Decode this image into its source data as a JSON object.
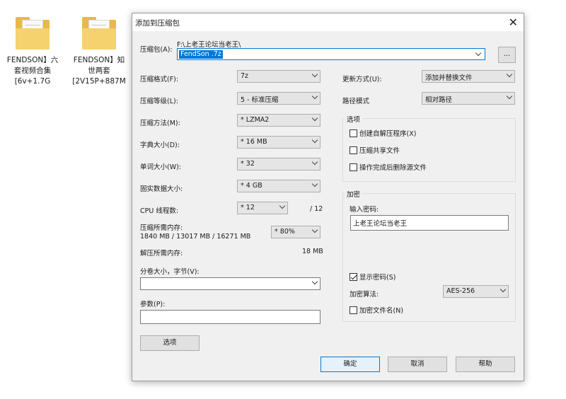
{
  "desktop": {
    "icons": [
      {
        "line1": "FENDSON】六",
        "line2": "套视频合集",
        "line3": "[6v+1.7G"
      },
      {
        "line1": "FENDSON】知",
        "line2": "世两套",
        "line3": "[2V15P+887M"
      }
    ]
  },
  "dialog": {
    "title": "添加到压缩包",
    "close_glyph": "✕",
    "archive": {
      "label": "压缩包(A):",
      "path": "F:\\上老王论坛当老王\\",
      "filename": "FendSon .7z",
      "browse_label": "..."
    },
    "left": {
      "format": {
        "label": "压缩格式(F):",
        "value": "7z"
      },
      "level": {
        "label": "压缩等级(L):",
        "value": "5 - 标准压缩"
      },
      "method": {
        "label": "压缩方法(M):",
        "value": "* LZMA2"
      },
      "dict": {
        "label": "字典大小(D):",
        "value": "* 16 MB"
      },
      "word": {
        "label": "单词大小(W):",
        "value": "* 32"
      },
      "solid": {
        "label": "固实数据大小:",
        "value": "* 4 GB"
      },
      "threads": {
        "label": "CPU 线程数:",
        "value": "* 12",
        "total": "/ 12"
      },
      "memory": {
        "label": "压缩所需内存:",
        "detail": "1840 MB / 13017 MB / 16271 MB",
        "value": "* 80%"
      },
      "decompress": {
        "label": "解压所需内存:",
        "value": "18 MB"
      },
      "volume": {
        "label": "分卷大小，字节(V):",
        "value": ""
      },
      "params": {
        "label": "参数(P):",
        "value": ""
      },
      "options_button": "选项"
    },
    "right": {
      "update": {
        "label": "更新方式(U):",
        "value": "添加并替换文件"
      },
      "path_mode": {
        "label": "路径模式",
        "value": "相对路径"
      },
      "options_group": {
        "title": "选项",
        "sfx": "创建自解压程序(X)",
        "shared": "压缩共享文件",
        "delete": "操作完成后删除源文件"
      },
      "encrypt_group": {
        "title": "加密",
        "password_label": "输入密码:",
        "password_value": "上老王论坛当老王",
        "show_password": "显示密码(S)",
        "method_label": "加密算法:",
        "method_value": "AES-256",
        "encrypt_names": "加密文件名(N)"
      }
    },
    "buttons": {
      "ok": "确定",
      "cancel": "取消",
      "help": "帮助"
    }
  }
}
